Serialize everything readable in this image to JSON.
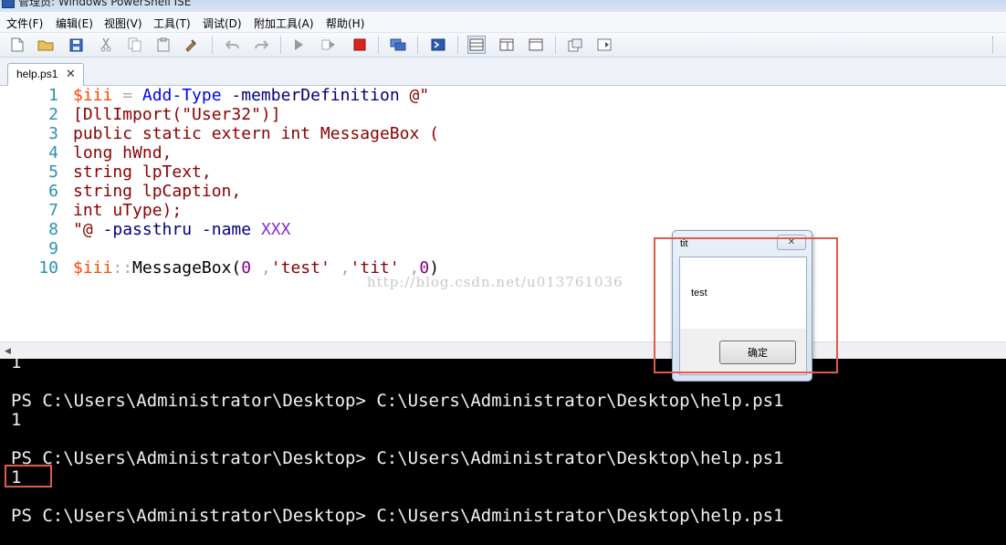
{
  "window": {
    "title": "管理员: Windows PowerShell ISE"
  },
  "menu": [
    "文件(F)",
    "编辑(E)",
    "视图(V)",
    "工具(T)",
    "调试(D)",
    "附加工具(A)",
    "帮助(H)"
  ],
  "toolbar": {
    "icons": [
      "new-file-icon",
      "open-folder-icon",
      "save-icon",
      "cut-icon",
      "copy-icon",
      "paste-icon",
      "clear-icon",
      "undo-icon",
      "redo-icon",
      "run-icon",
      "run-selection-icon",
      "stop-icon",
      "new-remote-tab-icon",
      "start-powershell-icon",
      "layout-top-icon",
      "layout-right-icon",
      "layout-max-icon",
      "show-commands-icon",
      "show-addons-icon"
    ]
  },
  "tab": {
    "label": "help.ps1",
    "close": "✕"
  },
  "editor": {
    "line_numbers": [
      "1",
      "2",
      "3",
      "4",
      "5",
      "6",
      "7",
      "8",
      "9",
      "10"
    ],
    "lines": [
      [
        {
          "t": "$iii",
          "c": "var"
        },
        {
          "t": " = ",
          "c": "op"
        },
        {
          "t": "Add-Type",
          "c": "cmd"
        },
        {
          "t": " ",
          "c": "plain"
        },
        {
          "t": "-memberDefinition",
          "c": "param"
        },
        {
          "t": " @\"",
          "c": "str"
        }
      ],
      [
        {
          "t": "[DllImport(\"User32\")]",
          "c": "str"
        }
      ],
      [
        {
          "t": "public static extern int MessageBox (",
          "c": "str"
        }
      ],
      [
        {
          "t": "long hWnd,",
          "c": "str"
        }
      ],
      [
        {
          "t": "string lpText,",
          "c": "str"
        }
      ],
      [
        {
          "t": "string lpCaption,",
          "c": "str"
        }
      ],
      [
        {
          "t": "int uType);",
          "c": "str"
        }
      ],
      [
        {
          "t": "\"@",
          "c": "str"
        },
        {
          "t": " ",
          "c": "plain"
        },
        {
          "t": "-passthru",
          "c": "param"
        },
        {
          "t": " ",
          "c": "plain"
        },
        {
          "t": "-name",
          "c": "param"
        },
        {
          "t": " ",
          "c": "plain"
        },
        {
          "t": "XXX",
          "c": "name"
        }
      ],
      [],
      [
        {
          "t": "$iii",
          "c": "var"
        },
        {
          "t": "::",
          "c": "op"
        },
        {
          "t": "MessageBox(",
          "c": "plain"
        },
        {
          "t": "0",
          "c": "num"
        },
        {
          "t": " ,",
          "c": "op"
        },
        {
          "t": "'test'",
          "c": "str"
        },
        {
          "t": " ,",
          "c": "op"
        },
        {
          "t": "'tit'",
          "c": "str"
        },
        {
          "t": " ,",
          "c": "op"
        },
        {
          "t": "0",
          "c": "num"
        },
        {
          "t": ")",
          "c": "plain"
        }
      ]
    ],
    "watermark": "http://blog.csdn.net/u013761036"
  },
  "console": {
    "lines": [
      "1",
      "",
      "PS C:\\Users\\Administrator\\Desktop> C:\\Users\\Administrator\\Desktop\\help.ps1",
      "1",
      "",
      "PS C:\\Users\\Administrator\\Desktop> C:\\Users\\Administrator\\Desktop\\help.ps1",
      "1",
      "",
      "PS C:\\Users\\Administrator\\Desktop> C:\\Users\\Administrator\\Desktop\\help.ps1"
    ]
  },
  "messagebox": {
    "title": "tit",
    "close": "✕",
    "message": "test",
    "ok_label": "确定"
  },
  "colors": {
    "var": "#ff4500",
    "operator": "#a9a9a9",
    "command": "#0000ff",
    "parameter": "#000080",
    "string": "#8b0000",
    "name": "#8a2be2",
    "number": "#800080",
    "line_number": "#2b91af",
    "console_bg": "#000000",
    "console_fg": "#f2f2f2",
    "highlight": "#e05a4a"
  }
}
